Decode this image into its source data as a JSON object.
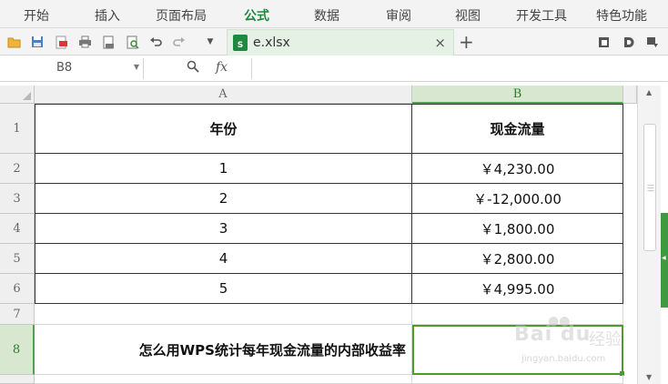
{
  "menubar": {
    "items": [
      "开始",
      "插入",
      "页面布局",
      "公式",
      "数据",
      "审阅",
      "视图",
      "开发工具",
      "特色功能"
    ],
    "active_index": 3
  },
  "toolbar": {
    "icons": [
      "open-folder-icon",
      "save-icon",
      "export-pdf-icon",
      "print-icon",
      "print-preview-icon",
      "preview-icon",
      "undo-icon",
      "redo-icon",
      "dropdown-arrow-icon"
    ],
    "right_icons": [
      "ribbon-toggle-icon",
      "skin-icon",
      "minimize-ribbon-icon"
    ]
  },
  "tab": {
    "file_name": "e.xlsx",
    "close_label": "×",
    "add_label": "+"
  },
  "formula_bar": {
    "name_box": "B8",
    "fx_label": "fx",
    "value": ""
  },
  "sheet": {
    "columns": [
      "A",
      "B"
    ],
    "selected_column": "B",
    "rows": [
      "1",
      "2",
      "3",
      "4",
      "5",
      "6",
      "7",
      "8"
    ],
    "selected_row": "8",
    "header": {
      "year": "年份",
      "cashflow": "现金流量"
    },
    "data": [
      {
        "year": "1",
        "cashflow": "￥4,230.00"
      },
      {
        "year": "2",
        "cashflow": "￥-12,000.00"
      },
      {
        "year": "3",
        "cashflow": "￥1,800.00"
      },
      {
        "year": "4",
        "cashflow": "￥2,800.00"
      },
      {
        "year": "5",
        "cashflow": "￥4,995.00"
      }
    ],
    "row8_label": "怎么用WPS统计每年现金流量的内部收益率",
    "row8_value": ""
  },
  "watermark": {
    "logo": "Bai du",
    "text": "经验",
    "url": "jingyan.baidu.com"
  },
  "colors": {
    "accent": "#1e8a3e",
    "selection": "#4e9a2e",
    "header_bg": "#efefef"
  }
}
